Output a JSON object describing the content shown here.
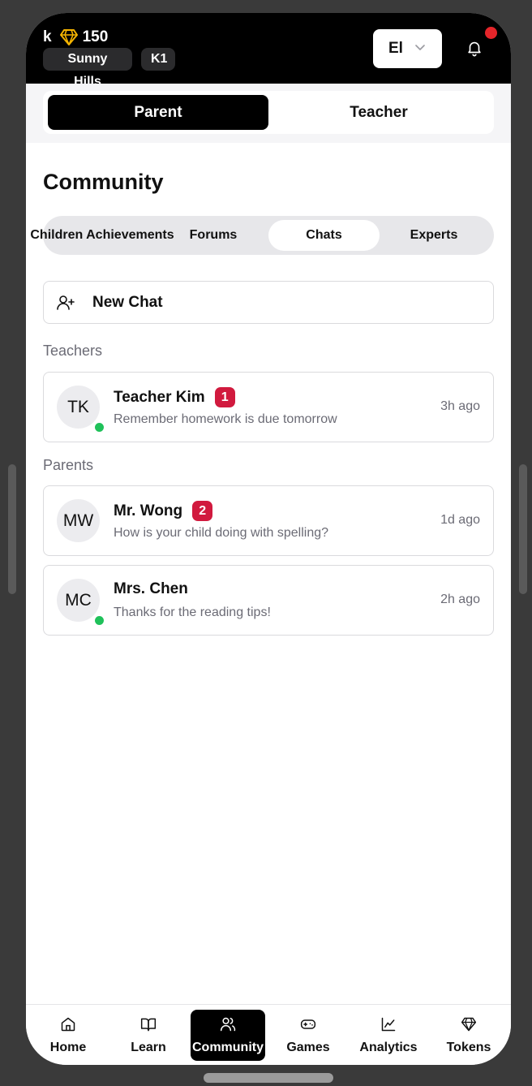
{
  "header": {
    "user_initial": "k",
    "gem_count": "150",
    "school": "Sunny Hills",
    "grade": "K1",
    "language": "El",
    "has_notification": true
  },
  "role_toggle": {
    "parent": "Parent",
    "teacher": "Teacher",
    "active": "Parent"
  },
  "page": {
    "title": "Community"
  },
  "tabs": {
    "items": [
      "Children Achievements",
      "Forums",
      "Chats",
      "Experts"
    ],
    "active": "Chats"
  },
  "new_chat": {
    "label": "New Chat"
  },
  "sections": {
    "teachers": {
      "title": "Teachers",
      "chats": [
        {
          "initials": "TK",
          "name": "Teacher Kim",
          "unread": "1",
          "message": "Remember homework is due tomorrow",
          "time": "3h ago",
          "online": true
        }
      ]
    },
    "parents": {
      "title": "Parents",
      "chats": [
        {
          "initials": "MW",
          "name": "Mr. Wong",
          "unread": "2",
          "message": "How is your child doing with spelling?",
          "time": "1d ago",
          "online": false
        },
        {
          "initials": "MC",
          "name": "Mrs. Chen",
          "unread": "",
          "message": "Thanks for the reading tips!",
          "time": "2h ago",
          "online": true
        }
      ]
    }
  },
  "bottom_nav": {
    "items": [
      {
        "label": "Home",
        "icon": "home-icon"
      },
      {
        "label": "Learn",
        "icon": "book-icon"
      },
      {
        "label": "Community",
        "icon": "users-icon"
      },
      {
        "label": "Games",
        "icon": "gamepad-icon"
      },
      {
        "label": "Analytics",
        "icon": "chart-icon"
      },
      {
        "label": "Tokens",
        "icon": "gem-icon"
      }
    ],
    "active": "Community"
  },
  "colors": {
    "accent": "#000000",
    "badge": "#d11a3e",
    "online": "#1fc15a",
    "gem": "#f5b400",
    "notification": "#e5252a"
  }
}
